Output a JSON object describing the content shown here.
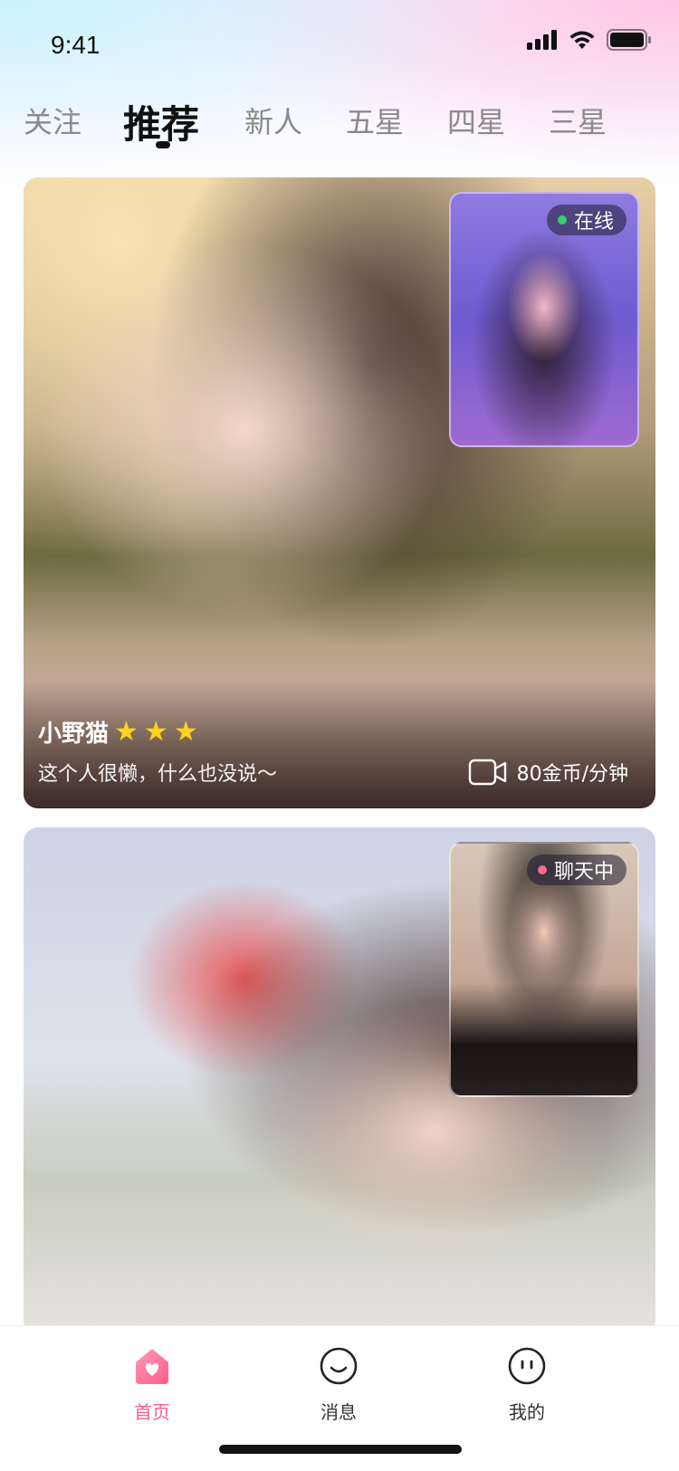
{
  "status_bar": {
    "time": "9:41"
  },
  "tabs": [
    {
      "label": "关注",
      "active": false
    },
    {
      "label": "推荐",
      "active": true
    },
    {
      "label": "新人",
      "active": false
    },
    {
      "label": "五星",
      "active": false
    },
    {
      "label": "四星",
      "active": false
    },
    {
      "label": "三星",
      "active": false
    }
  ],
  "cards": [
    {
      "name": "小野猫",
      "stars": 3,
      "bio": "这个人很懒，什么也没说～",
      "price": "80金币/分钟",
      "status": {
        "label": "在线",
        "color": "#2fd26a"
      }
    },
    {
      "status": {
        "label": "聊天中",
        "color": "#ff6b8b"
      }
    }
  ],
  "bottom_nav": [
    {
      "label": "首页",
      "icon": "home-heart-icon",
      "active": true
    },
    {
      "label": "消息",
      "icon": "message-smile-icon",
      "active": false
    },
    {
      "label": "我的",
      "icon": "profile-face-icon",
      "active": false
    }
  ],
  "colors": {
    "accent": "#ff5c8a",
    "star": "#ffd21f",
    "online": "#2fd26a",
    "chatting": "#ff6b8b"
  }
}
